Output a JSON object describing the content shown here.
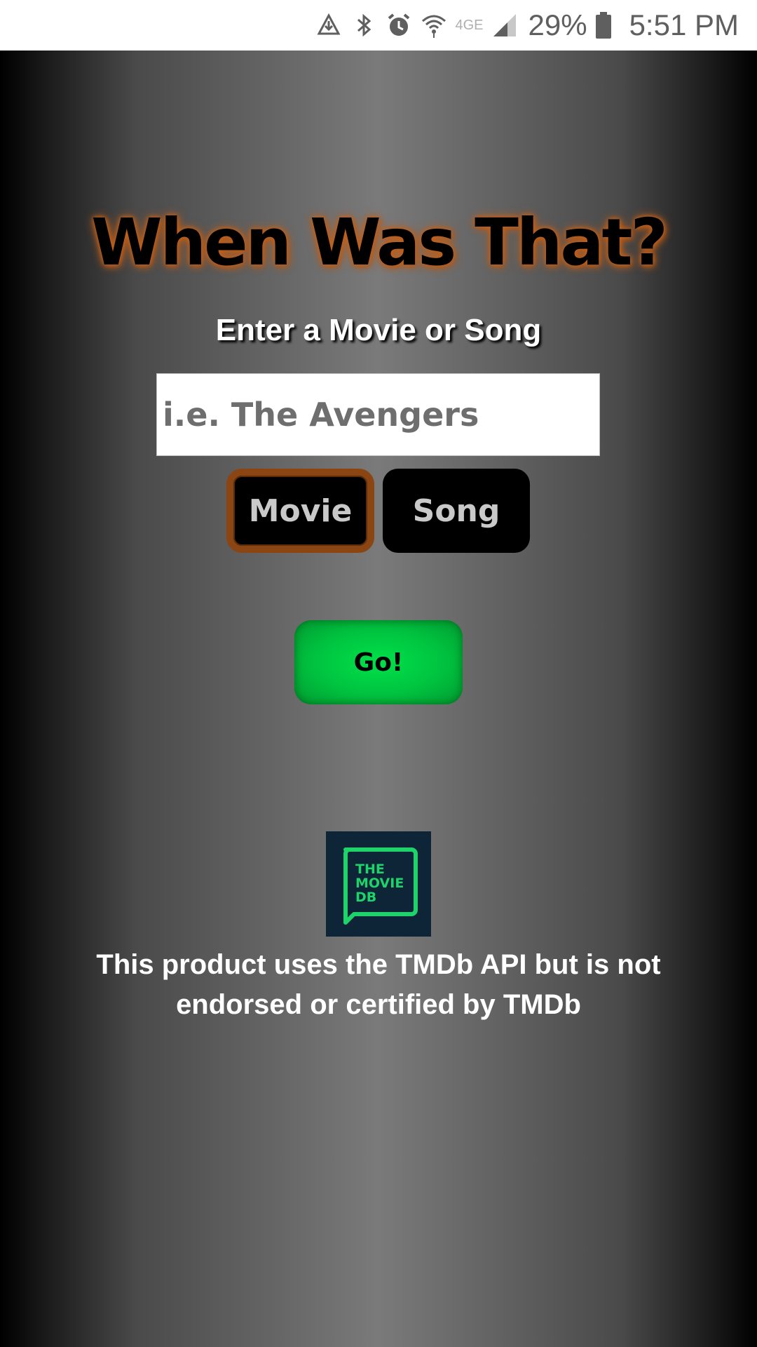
{
  "status_bar": {
    "battery_percent": "29%",
    "network": "4GE",
    "time": "5:51 PM"
  },
  "app": {
    "title": "When Was That?",
    "subtitle": "Enter a Movie or Song",
    "search": {
      "placeholder": "i.e. The Avengers",
      "value": ""
    },
    "type_buttons": {
      "movie_label": "Movie",
      "song_label": "Song",
      "selected": "Movie"
    },
    "go_label": "Go!",
    "logo_lines": [
      "THE",
      "MOVIE",
      "DB"
    ],
    "footer": "This product uses the TMDb API but is not endorsed or certified by TMDb",
    "colors": {
      "title_glow": "#c4621c",
      "selected_border": "#8b4513",
      "go_button": "#00c23f",
      "logo_bg": "#0d2536",
      "logo_green": "#1ed46a"
    }
  }
}
